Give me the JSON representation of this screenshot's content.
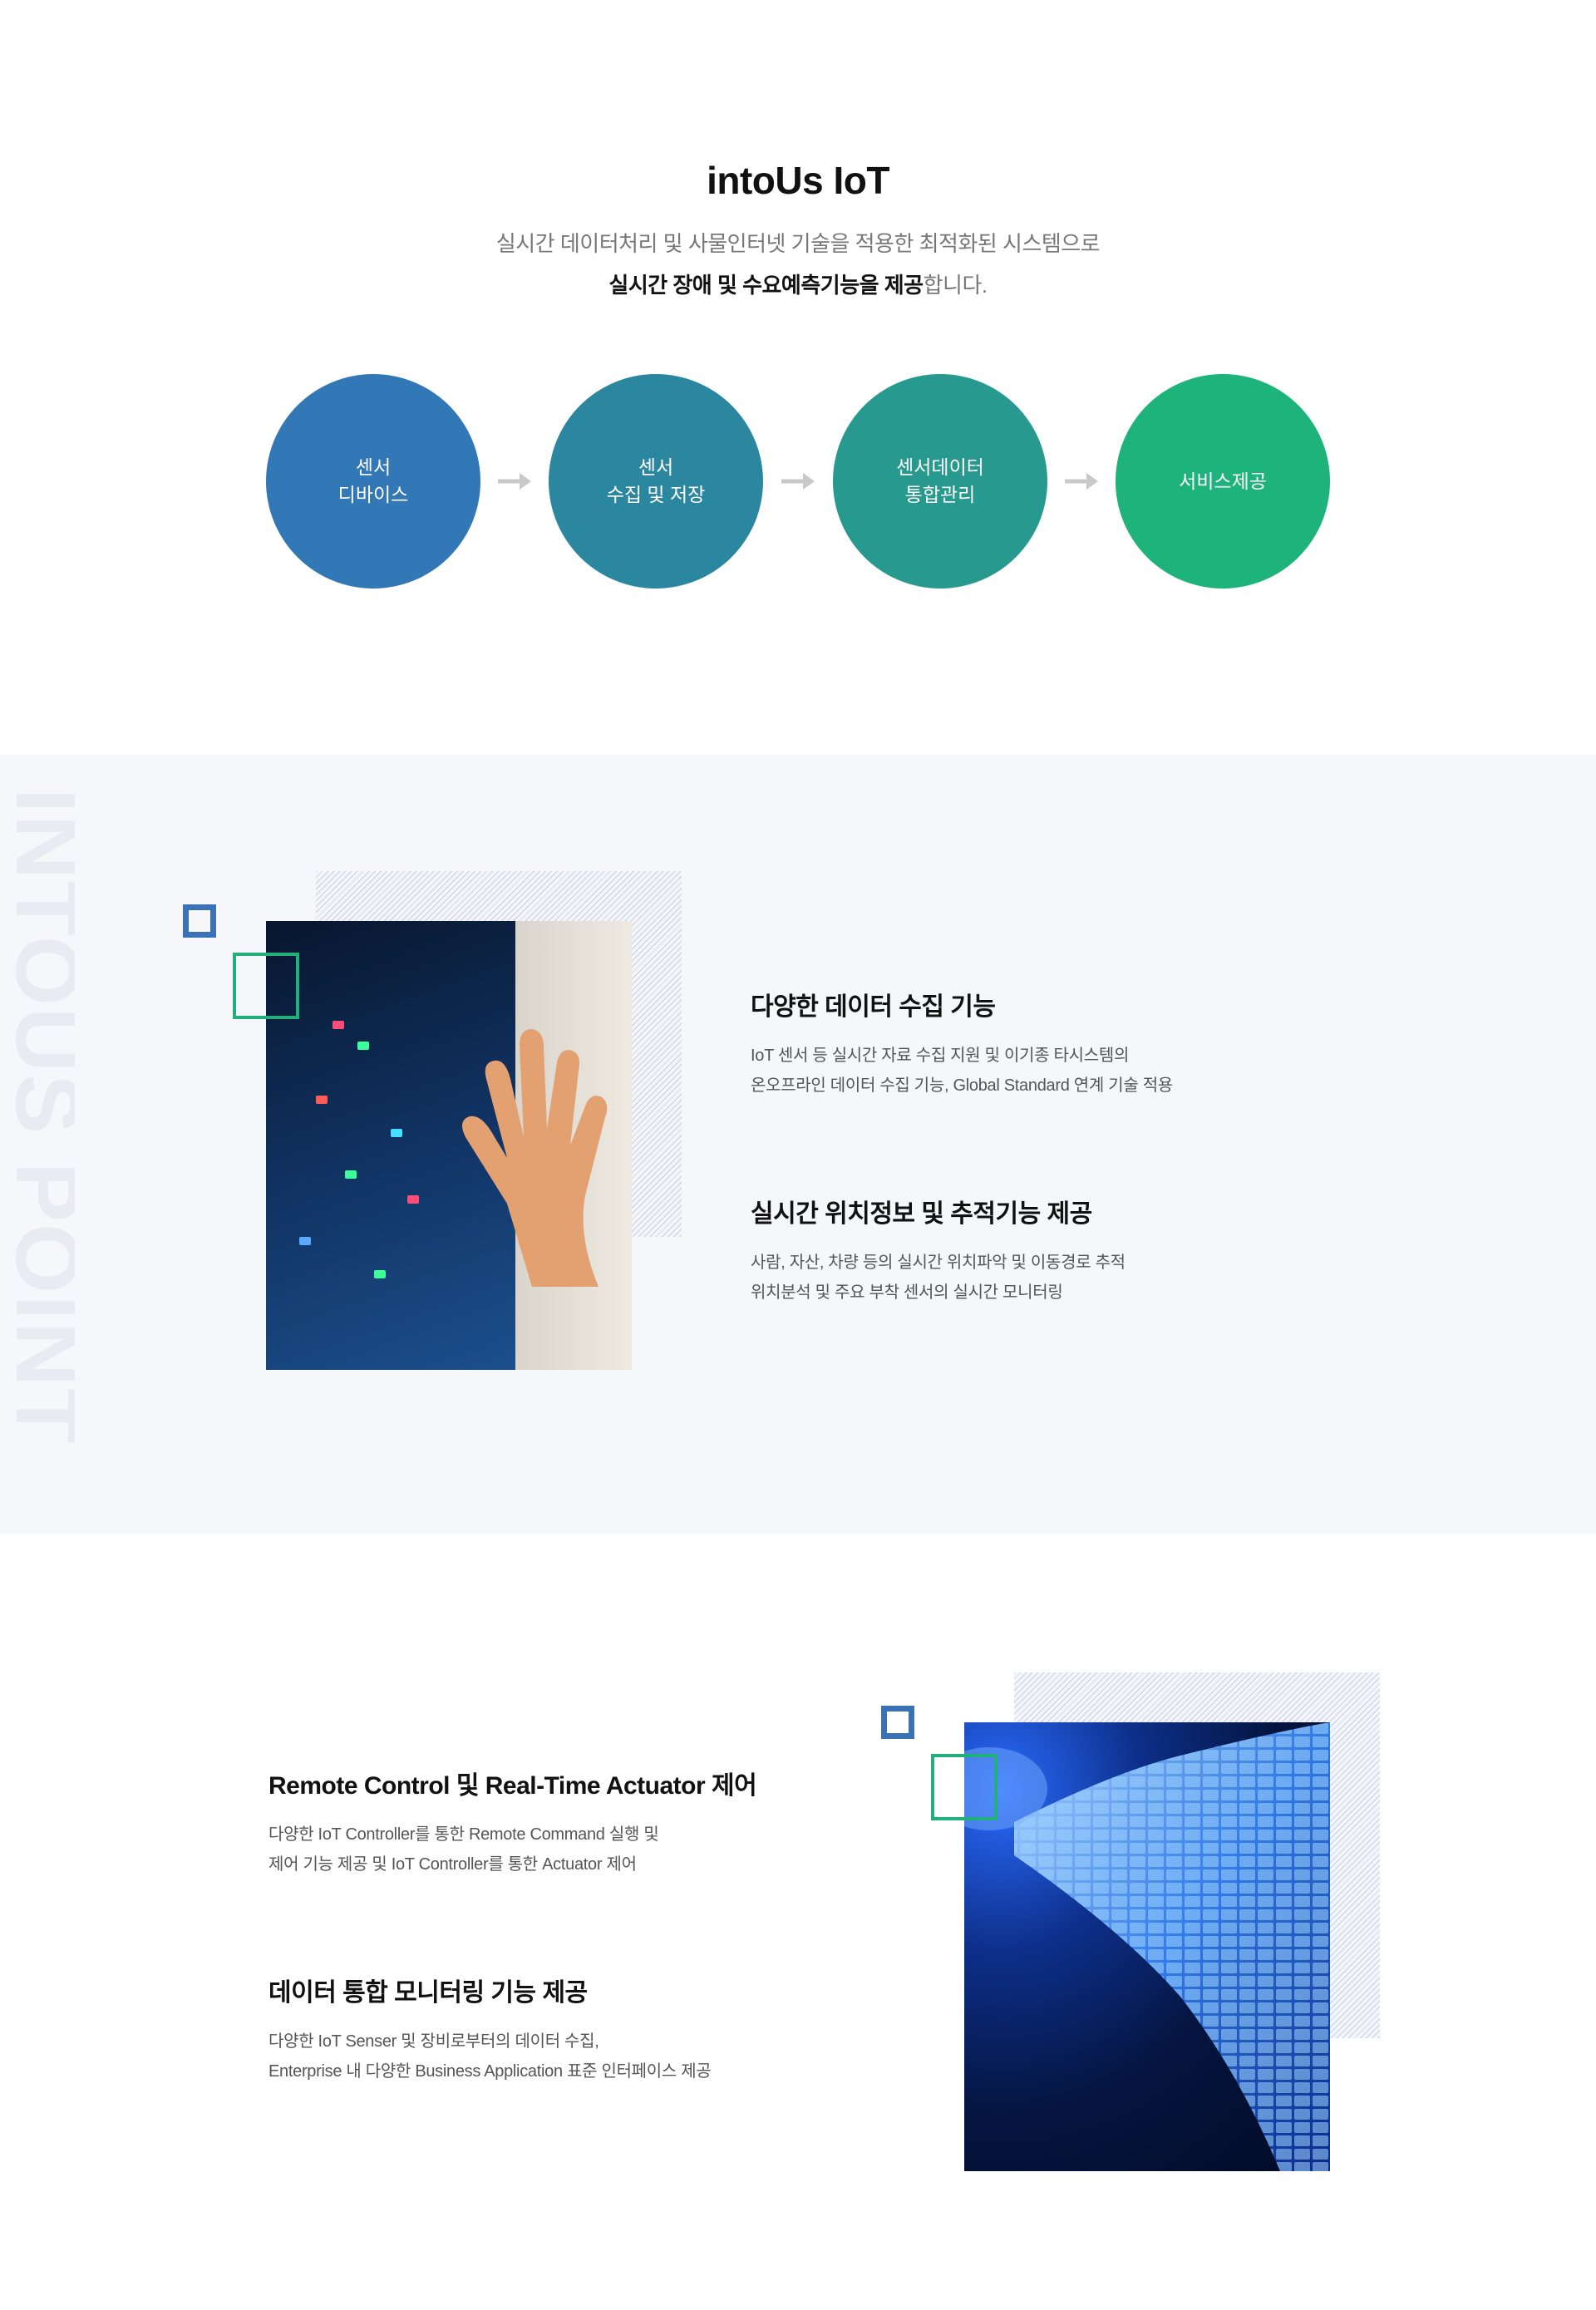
{
  "intro": {
    "title": "intoUs IoT",
    "desc_line1": "실시간 데이터처리 및 사물인터넷 기술을 적용한 최적화된 시스템으로",
    "desc_line2_strong": "실시간 장애 및 수요예측기능을 제공",
    "desc_line2_rest": "합니다."
  },
  "flow": {
    "steps": [
      {
        "line1": "센서",
        "line2": "디바이스"
      },
      {
        "line1": "센서",
        "line2": "수집 및 저장"
      },
      {
        "line1": "센서데이터",
        "line2": "통합관리"
      },
      {
        "line1": "서비스제공",
        "line2": ""
      }
    ],
    "colors": [
      "#3277b6",
      "#2b87a0",
      "#27998e",
      "#1db37a"
    ],
    "arrow_icon": "arrow-right-icon"
  },
  "points": {
    "watermark": "INTOUS POINT",
    "features": [
      {
        "title": "다양한 데이터 수집 기능",
        "desc1": "IoT 센서 등 실시간 자료 수집 지원 및 이기종 타시스템의",
        "desc2": "온오프라인 데이터 수집 기능, Global Standard 연계 기술 적용"
      },
      {
        "title": "실시간 위치정보 및 추적기능 제공",
        "desc1": "사람, 자산, 차량 등의 실시간 위치파악 및 이동경로 추적",
        "desc2": "위치분석 및 주요 부착 센서의 실시간 모니터링"
      }
    ]
  },
  "section3": {
    "features": [
      {
        "title": "Remote Control 및 Real-Time Actuator 제어",
        "desc1": "다양한 IoT Controller를 통한 Remote Command 실행 및",
        "desc2": "제어 기능 제공 및 IoT Controller를 통한 Actuator 제어"
      },
      {
        "title": "데이터 통합 모니터링 기능 제공",
        "desc1": "다양한 IoT Senser 및 장비로부터의 데이터 수집,",
        "desc2": "Enterprise 내 다양한 Business Application 표준 인터페이스 제공"
      }
    ]
  },
  "accent_colors": {
    "blue": "#3a71b7",
    "green": "#22b07a",
    "background": "#f6f7fa"
  }
}
